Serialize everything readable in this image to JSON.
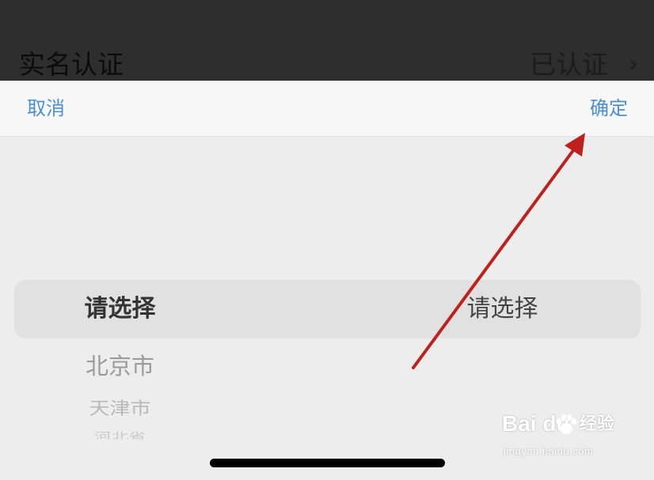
{
  "background_row": {
    "title": "实名认证",
    "value": "已认证",
    "chevron": "›"
  },
  "toolbar": {
    "cancel_label": "取消",
    "confirm_label": "确定",
    "accent_color": "#4a8fd6"
  },
  "picker": {
    "left_wheel": {
      "selected": "请选择",
      "items": [
        "北京市",
        "天津市",
        "河北省"
      ]
    },
    "right_wheel": {
      "selected": "请选择"
    }
  },
  "watermark": {
    "logo": "Bai du",
    "name": "经验",
    "url": "jingyan.baidu.com",
    "icon": "paw-icon"
  },
  "annotation": {
    "color": "#c0201c",
    "icon": "red-arrow-icon"
  }
}
